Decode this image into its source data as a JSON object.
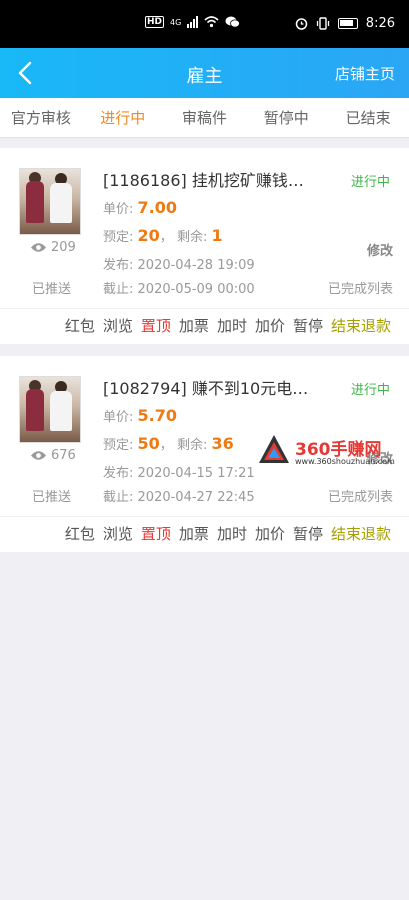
{
  "statusbar": {
    "net": "HD",
    "gen": "4G",
    "time": "8:26"
  },
  "navbar": {
    "title": "雇主",
    "right_link": "店铺主页"
  },
  "tabs": [
    {
      "label": "官方审核"
    },
    {
      "label": "进行中",
      "active": true
    },
    {
      "label": "审稿件"
    },
    {
      "label": "暂停中"
    },
    {
      "label": "已结束"
    }
  ],
  "tasks": [
    {
      "title": "[1186186] 挂机挖矿赚钱…",
      "status": "进行中",
      "views": "209",
      "pushed": "已推送",
      "unit_price_label": "单价:",
      "unit_price": "7.00",
      "booked_label": "预定:",
      "booked": "20",
      "remaining_label": "剩余:",
      "remaining": "1",
      "modify": "修改",
      "publish_label": "发布:",
      "publish_time": "2020-04-28 19:09",
      "deadline_label": "截止:",
      "deadline": "2020-05-09 00:00",
      "done_list": "已完成列表",
      "actions": [
        "红包",
        "浏览",
        "置顶",
        "加票",
        "加时",
        "加价",
        "暂停",
        "结束退款"
      ]
    },
    {
      "title": "[1082794] 赚不到10元电…",
      "status": "进行中",
      "views": "676",
      "pushed": "已推送",
      "unit_price_label": "单价:",
      "unit_price": "5.70",
      "booked_label": "预定:",
      "booked": "50",
      "remaining_label": "剩余:",
      "remaining": "36",
      "modify": "修改",
      "publish_label": "发布:",
      "publish_time": "2020-04-15 17:21",
      "deadline_label": "截止:",
      "deadline": "2020-04-27 22:45",
      "done_list": "已完成列表",
      "actions": [
        "红包",
        "浏览",
        "置顶",
        "加票",
        "加时",
        "加价",
        "暂停",
        "结束退款"
      ]
    }
  ],
  "watermark": {
    "text": "360手赚网",
    "url": "www.360shouzhuan.com"
  },
  "colors": {
    "nav": "#19b8f7",
    "active_tab": "#f08a24",
    "price": "#f07a12",
    "status": "#3cb84a",
    "top_action": "#e53935",
    "end_action": "#a5a000"
  }
}
